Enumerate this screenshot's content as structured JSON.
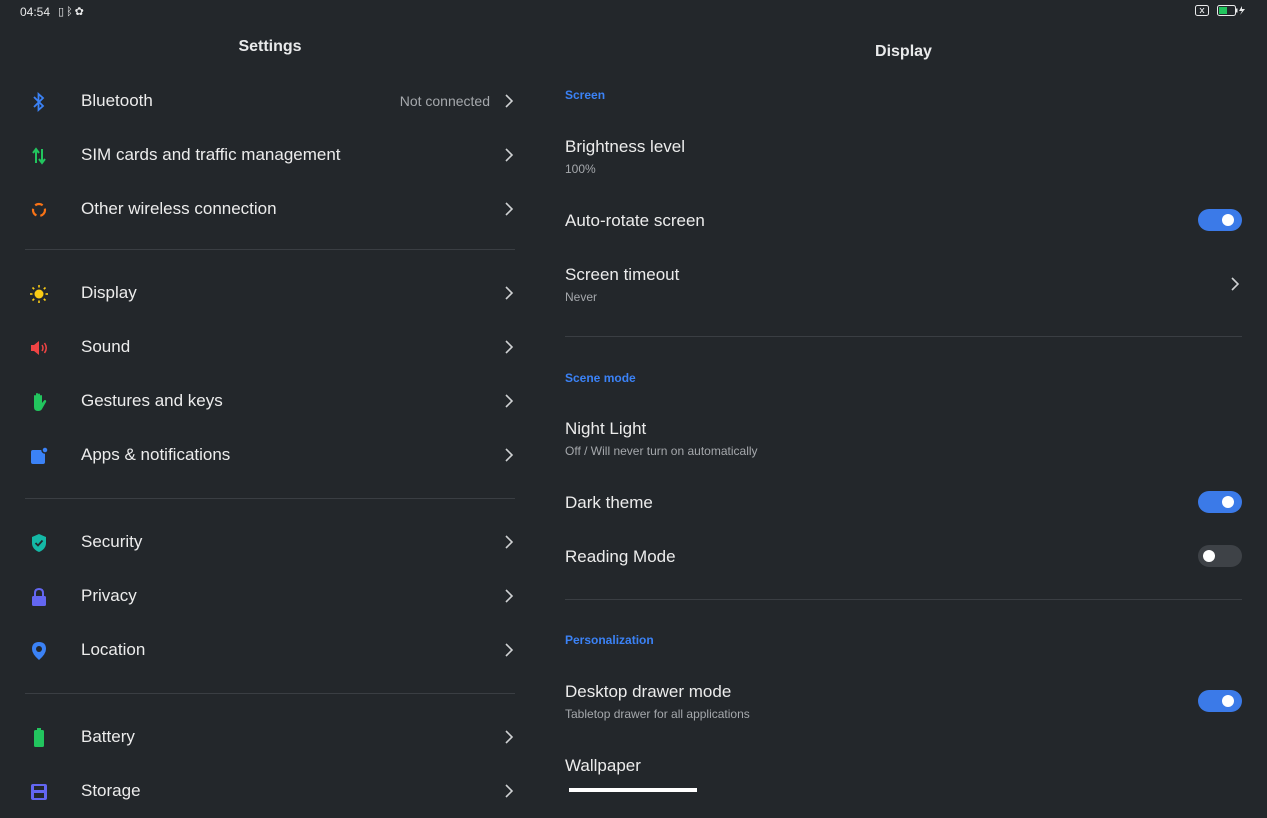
{
  "status_bar": {
    "time": "04:54",
    "left_icons": [
      "vibrate-icon",
      "bluetooth-icon",
      "settings-gear-icon"
    ],
    "right_icons": [
      "sim-icon",
      "battery-charging-icon"
    ]
  },
  "left_pane": {
    "title": "Settings",
    "items": [
      {
        "label": "Bluetooth",
        "status": "Not connected",
        "icon": "bluetooth-icon",
        "color": "#3b82f6"
      },
      {
        "label": "SIM cards and traffic management",
        "status": "",
        "icon": "sim-traffic-icon",
        "color": "#22c55e"
      },
      {
        "label": "Other wireless connection",
        "status": "",
        "icon": "wireless-icon",
        "color": "#f97316"
      },
      {
        "label": "Display",
        "status": "",
        "icon": "sun-icon",
        "color": "#facc15"
      },
      {
        "label": "Sound",
        "status": "",
        "icon": "speaker-icon",
        "color": "#ef4444"
      },
      {
        "label": "Gestures and keys",
        "status": "",
        "icon": "hand-icon",
        "color": "#22c55e"
      },
      {
        "label": "Apps & notifications",
        "status": "",
        "icon": "apps-icon",
        "color": "#3b82f6"
      },
      {
        "label": "Security",
        "status": "",
        "icon": "shield-icon",
        "color": "#14b8a6"
      },
      {
        "label": "Privacy",
        "status": "",
        "icon": "lock-icon",
        "color": "#6366f1"
      },
      {
        "label": "Location",
        "status": "",
        "icon": "location-pin-icon",
        "color": "#3b82f6"
      },
      {
        "label": "Battery",
        "status": "",
        "icon": "battery-icon",
        "color": "#22c55e"
      },
      {
        "label": "Storage",
        "status": "",
        "icon": "storage-icon",
        "color": "#6366f1"
      }
    ]
  },
  "right_pane": {
    "title": "Display",
    "sections": [
      {
        "header": "Screen",
        "items": [
          {
            "title": "Brightness level",
            "subtitle": "100%"
          },
          {
            "title": "Auto-rotate screen",
            "toggle": true
          },
          {
            "title": "Screen timeout",
            "subtitle": "Never",
            "chevron": true
          }
        ]
      },
      {
        "header": "Scene mode",
        "items": [
          {
            "title": "Night Light",
            "subtitle": "Off / Will never turn on automatically"
          },
          {
            "title": "Dark theme",
            "toggle": true
          },
          {
            "title": "Reading Mode",
            "toggle": false
          }
        ]
      },
      {
        "header": "Personalization",
        "items": [
          {
            "title": "Desktop drawer mode",
            "subtitle": "Tabletop drawer for all applications",
            "toggle": true
          },
          {
            "title": "Wallpaper"
          }
        ]
      }
    ]
  },
  "colors": {
    "background": "#23272b",
    "accent": "#3b82f6",
    "toggle_on": "#3b7ae8",
    "toggle_off": "#3e4247"
  }
}
